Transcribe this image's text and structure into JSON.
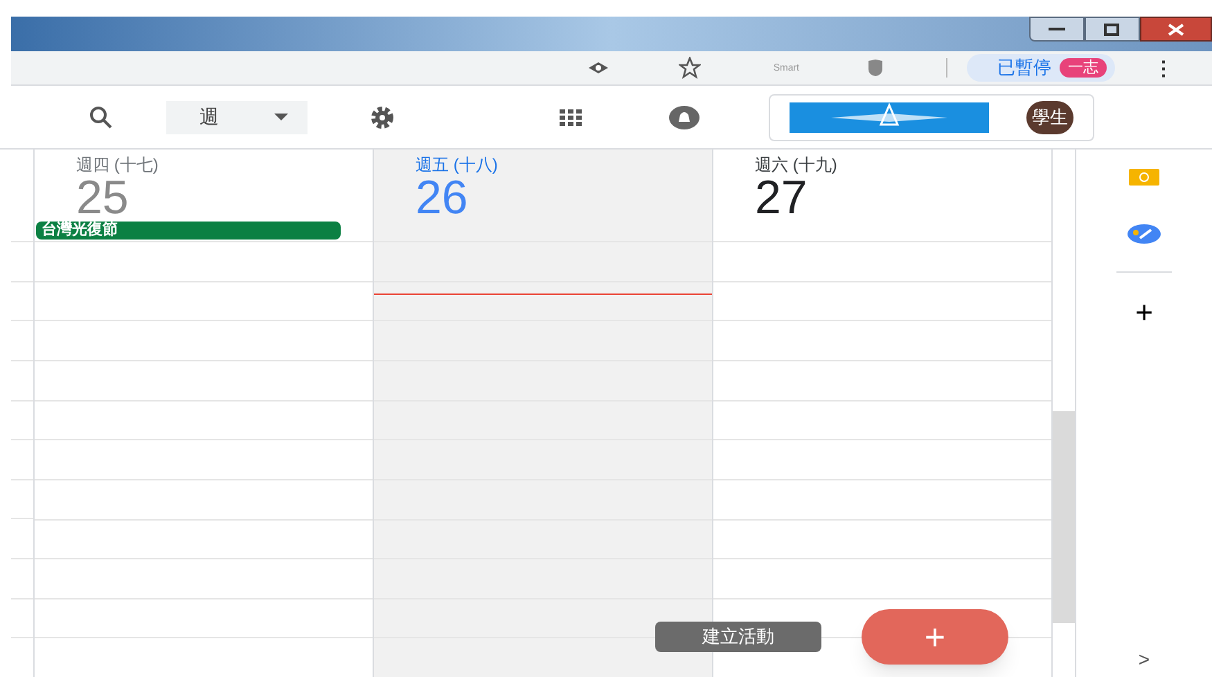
{
  "browser": {
    "smart_label": "Smart",
    "paused_label": "已暫停",
    "profile_badge": "一志",
    "menu_glyph": "⋮"
  },
  "header": {
    "view_label": "週",
    "user_label": "學生"
  },
  "days": [
    {
      "weekday": "週四 (十七)",
      "date": "25",
      "kind": "past",
      "events": [
        {
          "title": "台灣光復節",
          "color": "#0b8043"
        }
      ]
    },
    {
      "weekday": "週五 (十八)",
      "date": "26",
      "kind": "today"
    },
    {
      "weekday": "週六 (十九)",
      "date": "27",
      "kind": "future"
    }
  ],
  "fab": {
    "tooltip": "建立活動",
    "glyph": "+"
  },
  "side_panel": {
    "add_glyph": "+",
    "expand_glyph": ">"
  }
}
